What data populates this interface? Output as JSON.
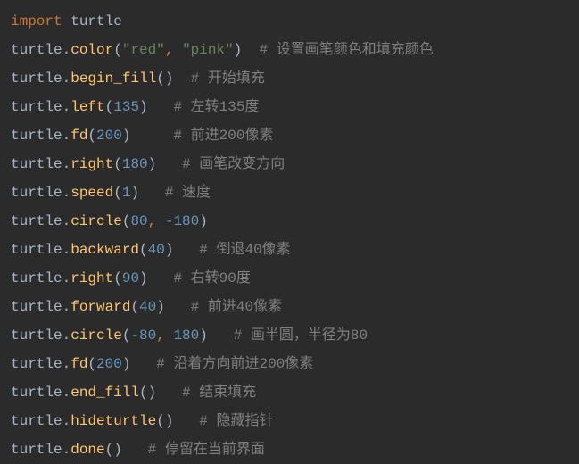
{
  "code": {
    "lines": [
      {
        "tokens": [
          {
            "type": "keyword",
            "text": "import"
          },
          {
            "type": "plain",
            "text": " "
          },
          {
            "type": "module",
            "text": "turtle"
          }
        ]
      },
      {
        "tokens": [
          {
            "type": "module",
            "text": "turtle"
          },
          {
            "type": "dot",
            "text": "."
          },
          {
            "type": "function",
            "text": "color"
          },
          {
            "type": "paren",
            "text": "("
          },
          {
            "type": "string",
            "text": "\"red\""
          },
          {
            "type": "comma",
            "text": ", "
          },
          {
            "type": "string",
            "text": "\"pink\""
          },
          {
            "type": "paren",
            "text": ")"
          },
          {
            "type": "plain",
            "text": "  "
          },
          {
            "type": "comment",
            "text": "# 设置画笔颜色和填充颜色"
          }
        ]
      },
      {
        "tokens": [
          {
            "type": "module",
            "text": "turtle"
          },
          {
            "type": "dot",
            "text": "."
          },
          {
            "type": "function",
            "text": "begin_fill"
          },
          {
            "type": "paren",
            "text": "()"
          },
          {
            "type": "plain",
            "text": "  "
          },
          {
            "type": "comment",
            "text": "# 开始填充"
          }
        ]
      },
      {
        "tokens": [
          {
            "type": "module",
            "text": "turtle"
          },
          {
            "type": "dot",
            "text": "."
          },
          {
            "type": "function",
            "text": "left"
          },
          {
            "type": "paren",
            "text": "("
          },
          {
            "type": "number",
            "text": "135"
          },
          {
            "type": "paren",
            "text": ")"
          },
          {
            "type": "plain",
            "text": "   "
          },
          {
            "type": "comment",
            "text": "# 左转135度"
          }
        ]
      },
      {
        "tokens": [
          {
            "type": "module",
            "text": "turtle"
          },
          {
            "type": "dot",
            "text": "."
          },
          {
            "type": "function",
            "text": "fd"
          },
          {
            "type": "paren",
            "text": "("
          },
          {
            "type": "number",
            "text": "200"
          },
          {
            "type": "paren",
            "text": ")"
          },
          {
            "type": "plain",
            "text": "     "
          },
          {
            "type": "comment",
            "text": "# 前进200像素"
          }
        ]
      },
      {
        "tokens": [
          {
            "type": "module",
            "text": "turtle"
          },
          {
            "type": "dot",
            "text": "."
          },
          {
            "type": "function",
            "text": "right"
          },
          {
            "type": "paren",
            "text": "("
          },
          {
            "type": "number",
            "text": "180"
          },
          {
            "type": "paren",
            "text": ")"
          },
          {
            "type": "plain",
            "text": "   "
          },
          {
            "type": "comment",
            "text": "# 画笔改变方向"
          }
        ]
      },
      {
        "tokens": [
          {
            "type": "module",
            "text": "turtle"
          },
          {
            "type": "dot",
            "text": "."
          },
          {
            "type": "function",
            "text": "speed"
          },
          {
            "type": "paren",
            "text": "("
          },
          {
            "type": "number",
            "text": "1"
          },
          {
            "type": "paren",
            "text": ")"
          },
          {
            "type": "plain",
            "text": "   "
          },
          {
            "type": "comment",
            "text": "# 速度"
          }
        ]
      },
      {
        "tokens": [
          {
            "type": "module",
            "text": "turtle"
          },
          {
            "type": "dot",
            "text": "."
          },
          {
            "type": "function",
            "text": "circle"
          },
          {
            "type": "paren",
            "text": "("
          },
          {
            "type": "number",
            "text": "80"
          },
          {
            "type": "comma",
            "text": ", "
          },
          {
            "type": "number",
            "text": "-180"
          },
          {
            "type": "paren",
            "text": ")"
          }
        ]
      },
      {
        "tokens": [
          {
            "type": "module",
            "text": "turtle"
          },
          {
            "type": "dot",
            "text": "."
          },
          {
            "type": "function",
            "text": "backward"
          },
          {
            "type": "paren",
            "text": "("
          },
          {
            "type": "number",
            "text": "40"
          },
          {
            "type": "paren",
            "text": ")"
          },
          {
            "type": "plain",
            "text": "   "
          },
          {
            "type": "comment",
            "text": "# 倒退40像素"
          }
        ]
      },
      {
        "tokens": [
          {
            "type": "module",
            "text": "turtle"
          },
          {
            "type": "dot",
            "text": "."
          },
          {
            "type": "function",
            "text": "right"
          },
          {
            "type": "paren",
            "text": "("
          },
          {
            "type": "number",
            "text": "90"
          },
          {
            "type": "paren",
            "text": ")"
          },
          {
            "type": "plain",
            "text": "   "
          },
          {
            "type": "comment",
            "text": "# 右转90度"
          }
        ]
      },
      {
        "tokens": [
          {
            "type": "module",
            "text": "turtle"
          },
          {
            "type": "dot",
            "text": "."
          },
          {
            "type": "function",
            "text": "forward"
          },
          {
            "type": "paren",
            "text": "("
          },
          {
            "type": "number",
            "text": "40"
          },
          {
            "type": "paren",
            "text": ")"
          },
          {
            "type": "plain",
            "text": "   "
          },
          {
            "type": "comment",
            "text": "# 前进40像素"
          }
        ]
      },
      {
        "tokens": [
          {
            "type": "module",
            "text": "turtle"
          },
          {
            "type": "dot",
            "text": "."
          },
          {
            "type": "function",
            "text": "circle"
          },
          {
            "type": "paren",
            "text": "("
          },
          {
            "type": "number",
            "text": "-80"
          },
          {
            "type": "comma",
            "text": ", "
          },
          {
            "type": "number",
            "text": "180"
          },
          {
            "type": "paren",
            "text": ")"
          },
          {
            "type": "plain",
            "text": "   "
          },
          {
            "type": "comment",
            "text": "# 画半圆，半径为80"
          }
        ]
      },
      {
        "tokens": [
          {
            "type": "module",
            "text": "turtle"
          },
          {
            "type": "dot",
            "text": "."
          },
          {
            "type": "function",
            "text": "fd"
          },
          {
            "type": "paren",
            "text": "("
          },
          {
            "type": "number",
            "text": "200"
          },
          {
            "type": "paren",
            "text": ")"
          },
          {
            "type": "plain",
            "text": "   "
          },
          {
            "type": "comment",
            "text": "# 沿着方向前进200像素"
          }
        ]
      },
      {
        "tokens": [
          {
            "type": "module",
            "text": "turtle"
          },
          {
            "type": "dot",
            "text": "."
          },
          {
            "type": "function",
            "text": "end_fill"
          },
          {
            "type": "paren",
            "text": "()"
          },
          {
            "type": "plain",
            "text": "   "
          },
          {
            "type": "comment",
            "text": "# 结束填充"
          }
        ]
      },
      {
        "tokens": [
          {
            "type": "module",
            "text": "turtle"
          },
          {
            "type": "dot",
            "text": "."
          },
          {
            "type": "function",
            "text": "hideturtle"
          },
          {
            "type": "paren",
            "text": "()"
          },
          {
            "type": "plain",
            "text": "   "
          },
          {
            "type": "comment",
            "text": "# 隐藏指针"
          }
        ]
      },
      {
        "tokens": [
          {
            "type": "module",
            "text": "turtle"
          },
          {
            "type": "dot",
            "text": "."
          },
          {
            "type": "function",
            "text": "done"
          },
          {
            "type": "paren",
            "text": "()"
          },
          {
            "type": "plain",
            "text": "   "
          },
          {
            "type": "comment",
            "text": "# 停留在当前界面"
          }
        ]
      }
    ]
  }
}
